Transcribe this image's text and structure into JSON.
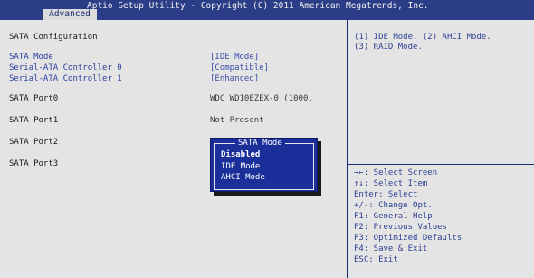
{
  "header": {
    "title": "Aptio Setup Utility - Copyright (C) 2011 American Megatrends, Inc.",
    "tab": "Advanced"
  },
  "section_title": "SATA Configuration",
  "settings": [
    {
      "label": "SATA Mode",
      "value": "[IDE Mode]"
    },
    {
      "label": "Serial-ATA Controller 0",
      "value": "[Compatible]"
    },
    {
      "label": "Serial-ATA Controller 1",
      "value": "[Enhanced]"
    }
  ],
  "ports": [
    {
      "label": "SATA Port0",
      "value": "WDC WD10EZEX-0 (1000."
    },
    {
      "label": "SATA Port1",
      "value": "Not Present"
    },
    {
      "label": "SATA Port2",
      "value": ""
    },
    {
      "label": "SATA Port3",
      "value": ""
    }
  ],
  "help_text": {
    "line1": "(1) IDE Mode. (2) AHCI Mode.",
    "line2": "(3) RAID Mode."
  },
  "popup": {
    "title": "SATA Mode",
    "options": [
      "Disabled",
      "IDE Mode",
      "AHCI Mode"
    ],
    "highlighted_index": 0
  },
  "key_help": [
    "→←: Select Screen",
    "↑↓: Select Item",
    "Enter: Select",
    "+/-: Change Opt.",
    "F1: General Help",
    "F2: Previous Values",
    "F3: Optimized Defaults",
    "F4: Save & Exit",
    "ESC: Exit"
  ],
  "colors": {
    "header_bg": "#2b3d86",
    "panel_bg": "#e4e4e4",
    "popup_bg": "#1b2f9a",
    "accent": "#3a4ea8"
  }
}
